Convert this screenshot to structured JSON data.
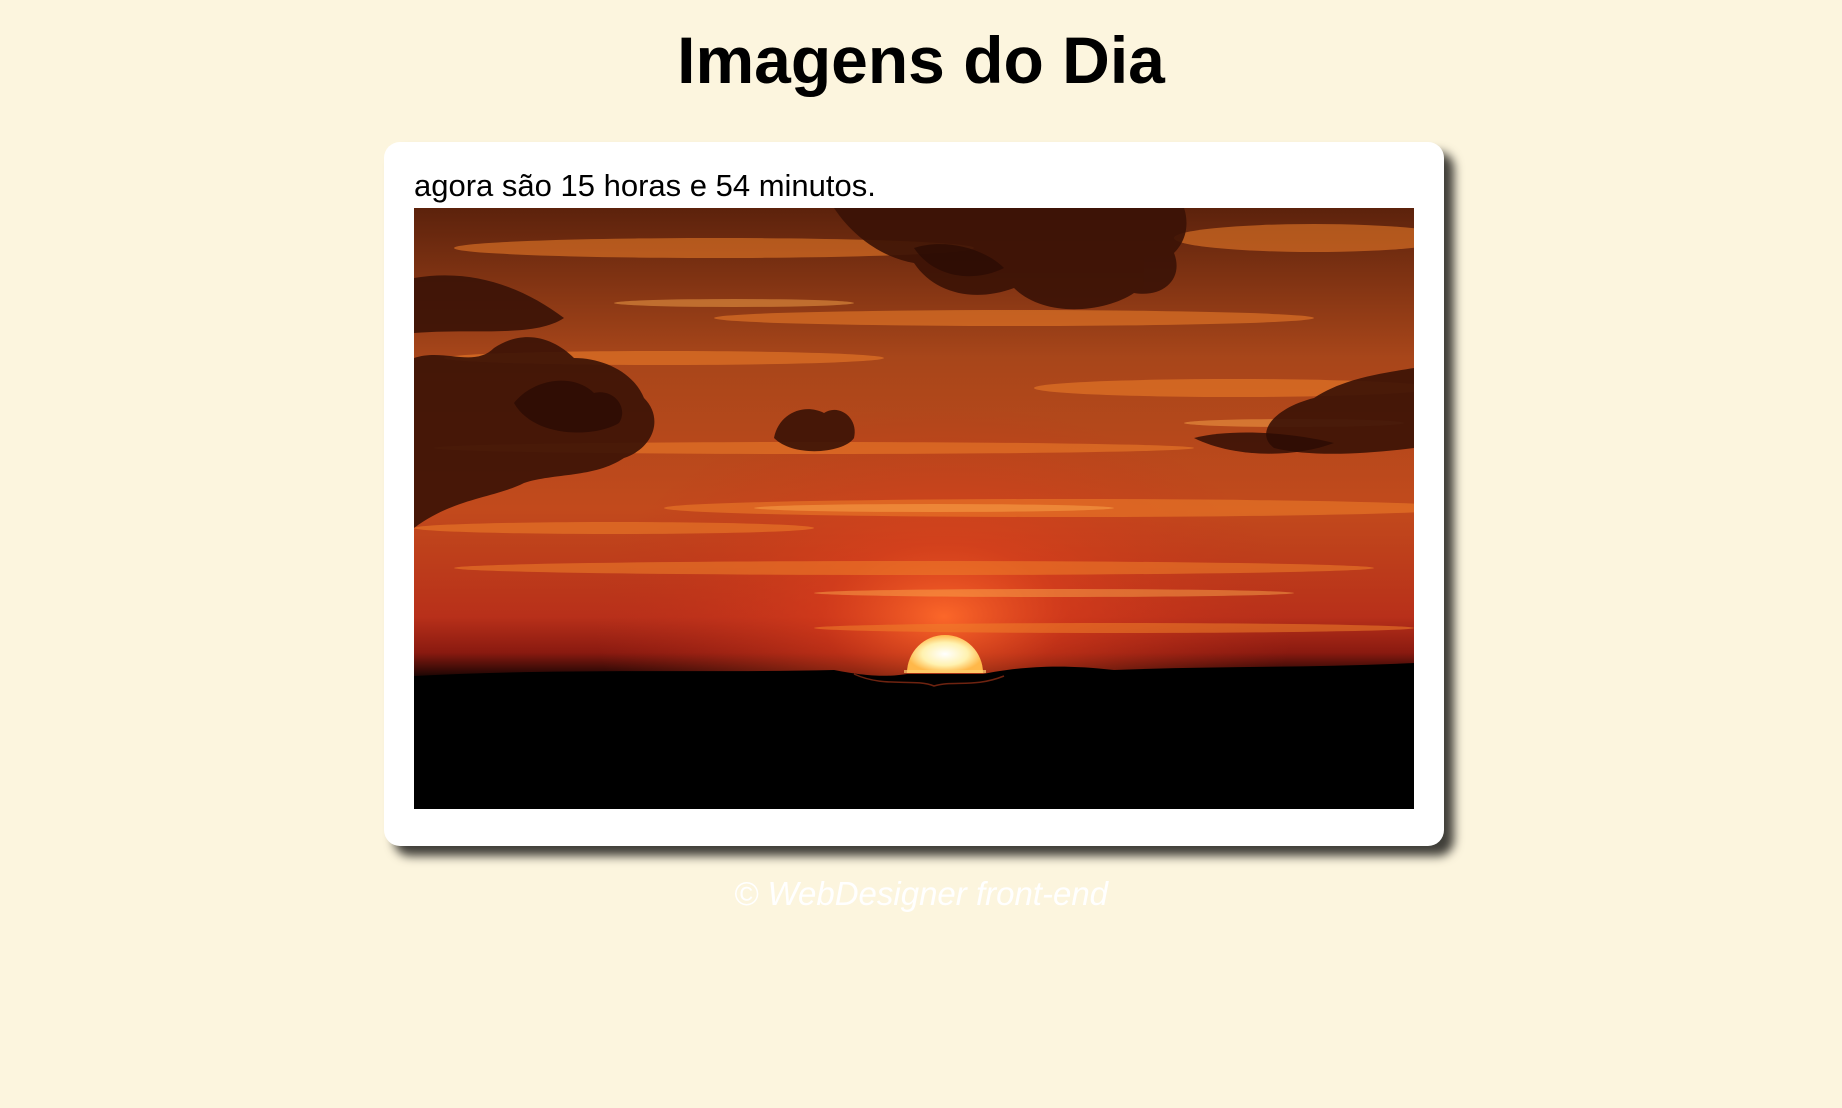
{
  "page": {
    "title": "Imagens do Dia",
    "time_message": "agora são 15 horas e 54 minutos.",
    "footer": "© WebDesigner front-end"
  },
  "image": {
    "subject": "sunset",
    "colors": {
      "sky_top": "#6e2a0e",
      "sky_mid": "#c0441a",
      "horizon": "#d2361a",
      "ground": "#000000",
      "sun": "#fff6c8",
      "background": "#fcf5de"
    }
  }
}
